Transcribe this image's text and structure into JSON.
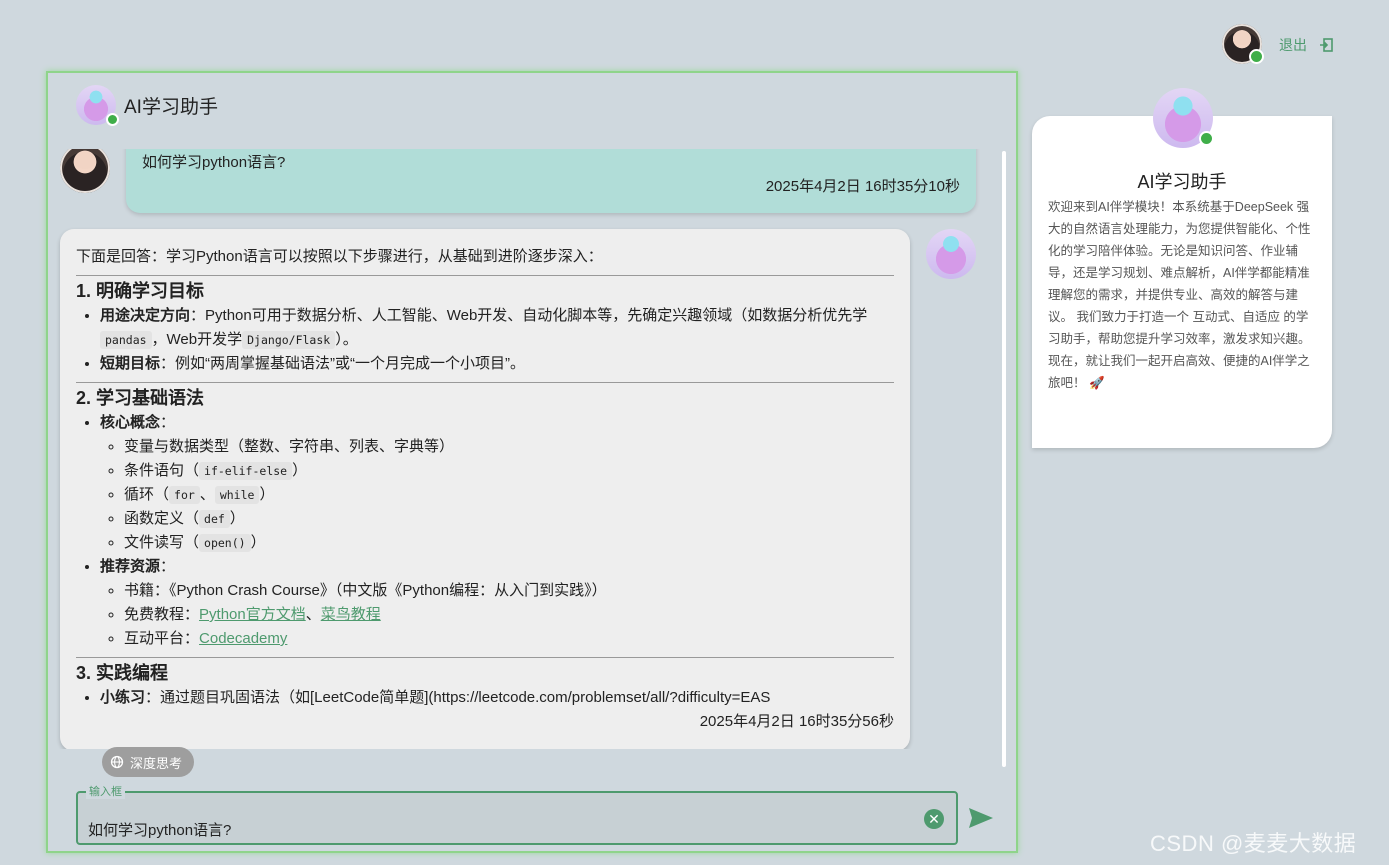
{
  "header": {
    "logout_label": "退出",
    "user_avatar": "user-avatar-photo"
  },
  "chat": {
    "title": "AI学习助手",
    "user_message": {
      "text": "如何学习python语言?",
      "timestamp": "2025年4月2日 16时35分10秒"
    },
    "bot_message": {
      "intro": "下面是回答：学习Python语言可以按照以下步骤进行，从基础到进阶逐步深入：",
      "s1_title": "1. 明确学习目标",
      "s1_i1_label": "用途决定方向",
      "s1_i1_text_a": "：Python可用于数据分析、人工智能、Web开发、自动化脚本等，先确定兴趣领域（如数据分析优先学",
      "s1_i1_code1": "pandas",
      "s1_i1_text_b": "，Web开发学",
      "s1_i1_code2": "Django/Flask",
      "s1_i1_text_c": "）。",
      "s1_i2_label": "短期目标",
      "s1_i2_text": "：例如“两周掌握基础语法”或“一个月完成一个小项目”。",
      "s2_title": "2. 学习基础语法",
      "s2_i1_label": "核心概念",
      "s2_i1_colon": "：",
      "s2_sub1": "变量与数据类型（整数、字符串、列表、字典等）",
      "s2_sub2_text": "条件语句（",
      "s2_sub2_code": "if-elif-else",
      "s2_sub3_text": "循环（",
      "s2_sub3_code1": "for",
      "s2_sub3_sep": "、",
      "s2_sub3_code2": "while",
      "s2_sub4_text": "函数定义（",
      "s2_sub4_code": "def",
      "s2_sub5_text": "文件读写（",
      "s2_sub5_code": "open()",
      "close_paren": "）",
      "s2_i2_label": "推荐资源",
      "s2_i2_colon": "：",
      "s2_r1": "书籍：《Python Crash Course》（中文版《Python编程：从入门到实践》）",
      "s2_r2_text": "免费教程：",
      "s2_r2_link1": "Python官方文档",
      "s2_r2_sep": "、",
      "s2_r2_link2": "菜鸟教程",
      "s2_r3_text": "互动平台：",
      "s2_r3_link": "Codecademy",
      "s3_title": "3. 实践编程",
      "s3_i1_label": "小练习",
      "s3_i1_text": "：通过题目巩固语法（如[LeetCode简单题](https://leetcode.com/problemset/all/?difficulty=EAS",
      "timestamp": "2025年4月2日 16时35分56秒"
    },
    "deep_think_label": "深度思考",
    "input": {
      "label": "输入框",
      "value": "如何学习python语言?"
    }
  },
  "info_card": {
    "title": "AI学习助手",
    "text": "欢迎来到AI伴学模块！本系统基于DeepSeek 强大的自然语言处理能力，为您提供智能化、个性化的学习陪伴体验。无论是知识问答、作业辅导，还是学习规划、难点解析，AI伴学都能精准理解您的需求，并提供专业、高效的解答与建议。 我们致力于打造一个 互动式、自适应 的学习助手，帮助您提升学习效率，激发求知兴趣。现在，就让我们一起开启高效、便捷的AI伴学之旅吧！ 🚀"
  },
  "watermark": "CSDN @麦麦大数据",
  "colors": {
    "accent": "#4e9a6e",
    "user_bubble": "#b1ddd8",
    "bot_bubble": "#eeeeee",
    "background": "#cfd8de"
  }
}
